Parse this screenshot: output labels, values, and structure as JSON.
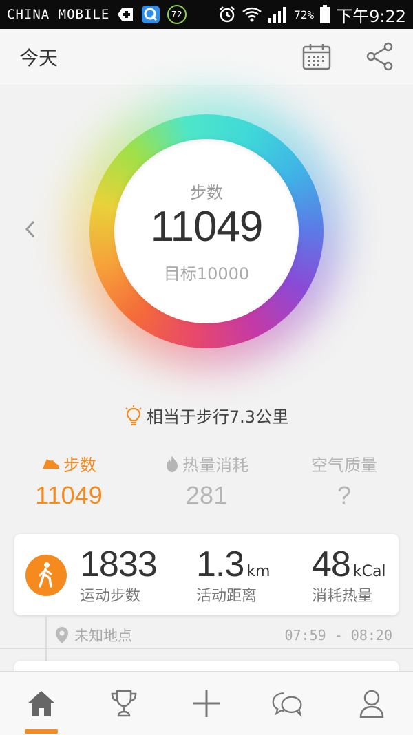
{
  "status_bar": {
    "carrier": "CHINA MOBILE",
    "badge_value": "72",
    "battery": "72%",
    "time": "下午9:22"
  },
  "header": {
    "title": "今天",
    "calendar_icon": "calendar-icon",
    "share_icon": "share-icon"
  },
  "ring": {
    "label": "步数",
    "value": "11049",
    "goal": "目标10000",
    "progress": 1.0
  },
  "tip": {
    "text": "相当于步行7.3公里",
    "icon": "lightbulb-icon"
  },
  "metrics": [
    {
      "label": "步数",
      "value": "11049",
      "icon": "shoe-icon",
      "color": "#f58a1f",
      "active": true
    },
    {
      "label": "热量消耗",
      "value": "281",
      "icon": "flame-icon",
      "color": "#b5b5b5",
      "active": false
    },
    {
      "label": "空气质量",
      "value": "?",
      "icon": "",
      "color": "#b5b5b5",
      "active": false
    }
  ],
  "activity_card": {
    "steps": {
      "value": "1833",
      "unit": "",
      "label": "运动步数"
    },
    "distance": {
      "value": "1.3",
      "unit": "km",
      "label": "活动距离"
    },
    "calories": {
      "value": "48",
      "unit": "kCal",
      "label": "消耗热量"
    }
  },
  "location": {
    "name": "未知地点",
    "time_range": "07:59 - 08:20"
  },
  "tabs": [
    {
      "name": "home",
      "icon": "home-icon",
      "active": true
    },
    {
      "name": "trophy",
      "icon": "trophy-icon",
      "active": false
    },
    {
      "name": "add",
      "icon": "plus-icon",
      "active": false
    },
    {
      "name": "chat",
      "icon": "chat-icon",
      "active": false
    },
    {
      "name": "profile",
      "icon": "profile-icon",
      "active": false
    }
  ],
  "colors": {
    "accent": "#f58a1f",
    "inactive": "#b5b5b5"
  }
}
